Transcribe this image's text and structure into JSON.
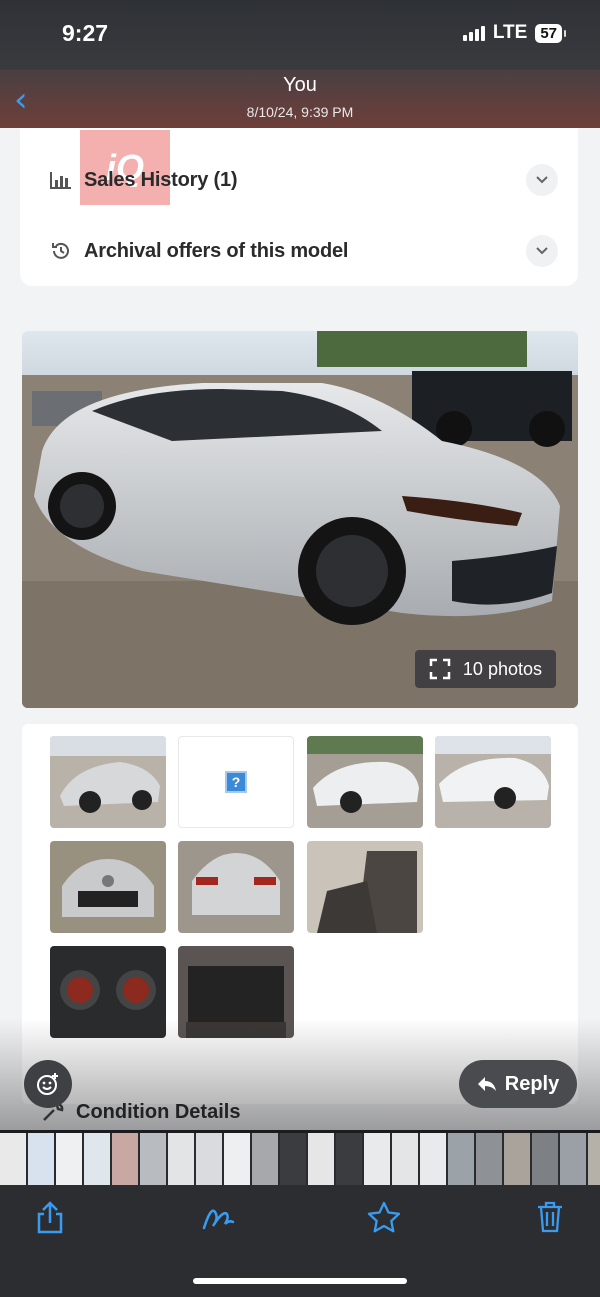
{
  "status_bar": {
    "time": "9:27",
    "network": "LTE",
    "battery": "57"
  },
  "header": {
    "title": "You",
    "subtitle": "8/10/24, 9:39 PM"
  },
  "watermark": {
    "text": "iQ"
  },
  "sections": [
    {
      "label": "Sales History (1)",
      "icon": "bar-chart-icon"
    },
    {
      "label": "Archival offers of this model",
      "icon": "history-icon"
    }
  ],
  "main_photo": {
    "badge_label": "10 photos",
    "subject": "silver sedan"
  },
  "thumbnails": [
    {
      "kind": "car-side"
    },
    {
      "kind": "missing",
      "glyph": "?"
    },
    {
      "kind": "car-rear-angle"
    },
    {
      "kind": "car-side-bright"
    },
    {
      "kind": "car-front"
    },
    {
      "kind": "car-rear"
    },
    {
      "kind": "interior-seats"
    },
    {
      "kind": "dashboard"
    },
    {
      "kind": "rear-seats"
    }
  ],
  "condition_section": {
    "label": "Condition Details"
  },
  "actions": {
    "reply_label": "Reply"
  },
  "toolbar": {
    "items": [
      "share-icon",
      "markup-icon",
      "favorite-icon",
      "trash-icon"
    ]
  },
  "colors": {
    "accent": "#3a9cf0",
    "card": "#ffffff",
    "background": "#f2f3f5"
  }
}
